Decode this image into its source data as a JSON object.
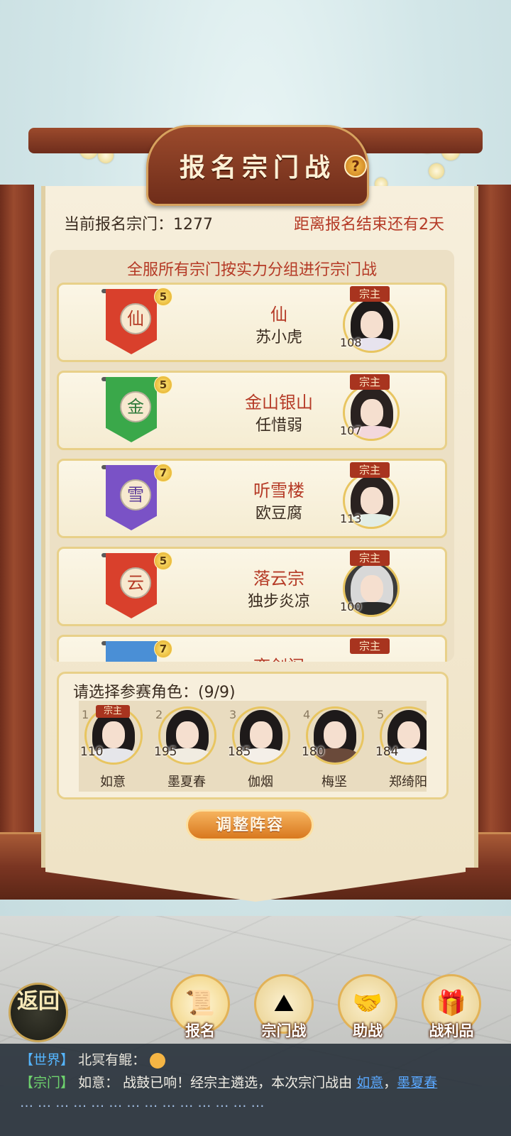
{
  "header": {
    "title": "报名宗门战",
    "help_icon": "?"
  },
  "info": {
    "count_text": "当前报名宗门：1277",
    "countdown_text": "距离报名结束还有2天"
  },
  "list_caption": "全服所有宗门按实力分组进行宗门战",
  "leader_tag": "宗主",
  "sects": [
    {
      "banner_char": "仙",
      "level": "5",
      "name": "仙",
      "leader": "苏小虎",
      "power": "108",
      "color": "#d9402c"
    },
    {
      "banner_char": "金",
      "level": "5",
      "name": "金山银山",
      "leader": "任惜弱",
      "power": "107",
      "color": "#3aa84a"
    },
    {
      "banner_char": "雪",
      "level": "7",
      "name": "听雪楼",
      "leader": "欧豆腐",
      "power": "113",
      "color": "#7a52c6"
    },
    {
      "banner_char": "云",
      "level": "5",
      "name": "落云宗",
      "leader": "独步炎凉",
      "power": "100",
      "color": "#d9402c"
    },
    {
      "banner_char": "",
      "level": "7",
      "name": "弈剑阁",
      "leader": "",
      "power": "",
      "color": "#4a8fd6"
    }
  ],
  "members": {
    "label": "请选择参赛角色：(9/9)",
    "list": [
      {
        "slot": "1",
        "power": "110",
        "name": "如意"
      },
      {
        "slot": "2",
        "power": "195",
        "name": "墨夏春"
      },
      {
        "slot": "3",
        "power": "185",
        "name": "伽烟"
      },
      {
        "slot": "4",
        "power": "180",
        "name": "梅坚"
      },
      {
        "slot": "5",
        "power": "184",
        "name": "郑绮阳"
      }
    ]
  },
  "adjust_button": "调整阵容",
  "back_button": "返回",
  "nav": [
    {
      "label": "报名",
      "icon": "scroll-icon"
    },
    {
      "label": "宗门战",
      "icon": "flag-mountain-icon"
    },
    {
      "label": "助战",
      "icon": "handshake-icon"
    },
    {
      "label": "战利品",
      "icon": "treasure-chest-icon"
    }
  ],
  "chat": {
    "line1": {
      "channel": "【世界】",
      "sender": "北冥有鲲："
    },
    "line2": {
      "channel": "【宗门】",
      "sender": "如意：",
      "message": "战鼓已响！经宗主遴选，本次宗门战由",
      "link1": "如意",
      "sep": "，",
      "link2": "墨夏春"
    },
    "line3": "… … … … … … … … … … … … … …"
  }
}
